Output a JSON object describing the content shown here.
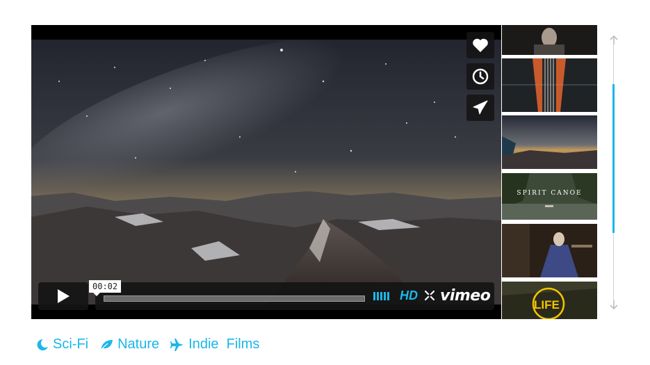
{
  "player": {
    "timecode": "00:02",
    "progress_fraction": 0.0,
    "hd_label": "HD",
    "brand_label": "vimeo",
    "side_buttons": [
      "heart-icon",
      "clock-icon",
      "send-icon"
    ]
  },
  "thumbnails": [
    {
      "name": "thumb-portrait",
      "label": ""
    },
    {
      "name": "thumb-guitar",
      "label": ""
    },
    {
      "name": "thumb-night-sky",
      "label": ""
    },
    {
      "name": "thumb-spirit-canoe",
      "label": "SPIRIT CANOE"
    },
    {
      "name": "thumb-costume",
      "label": ""
    },
    {
      "name": "thumb-life",
      "label": "LIFE"
    }
  ],
  "tags": [
    {
      "label": "Sci-Fi",
      "icon": "moon-icon"
    },
    {
      "label": "Nature",
      "icon": "leaf-icon"
    },
    {
      "label": "Indie  Films",
      "icon": "plane-icon"
    }
  ],
  "colors": {
    "accent": "#1ab7ea",
    "player_bg": "#000000",
    "control_bg": "#141414"
  }
}
